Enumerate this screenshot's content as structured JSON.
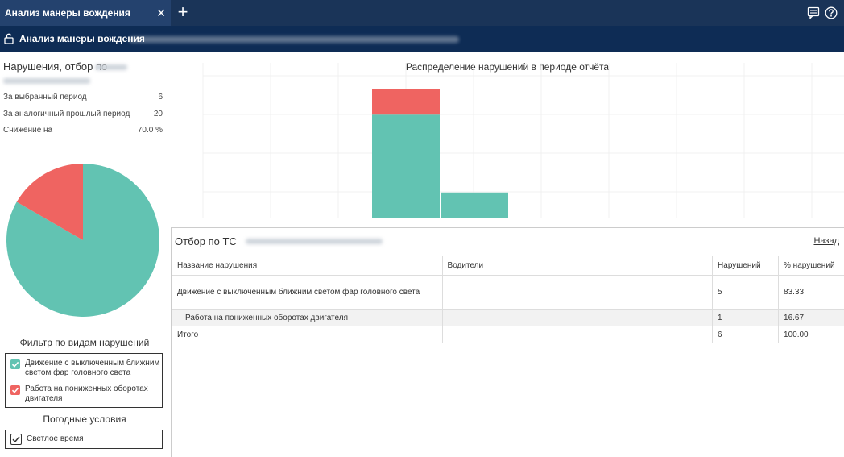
{
  "tab": {
    "title": "Анализ манеры вождения",
    "close": "✕",
    "add": "+"
  },
  "header": {
    "title": "Анализ манеры вождения"
  },
  "left": {
    "violations_title": "Нарушения, отбор по",
    "stats": [
      {
        "label": "За выбранный период",
        "value": "6"
      },
      {
        "label": "За аналогичный прошлый период",
        "value": "20"
      },
      {
        "label": "Снижение на",
        "value": "70.0 %"
      }
    ],
    "filter_title": "Фильтр по видам нарушений",
    "filters": [
      {
        "label": "Движение с выключенным ближним светом фар головного света",
        "color": "#62c3b2"
      },
      {
        "label": "Работа на пониженных оборотах двигателя",
        "color": "#ef6461"
      }
    ],
    "weather_title": "Погодные условия",
    "weather": [
      {
        "label": "Светлое время"
      }
    ]
  },
  "chart_data": [
    {
      "type": "pie",
      "categories": [
        "Движение с выключенным ближним светом фар головного света",
        "Работа на пониженных оборотах двигателя"
      ],
      "values": [
        5,
        1
      ],
      "colors": [
        "#62c3b2",
        "#ef6461"
      ]
    },
    {
      "type": "bar",
      "title": "Распределение нарушений в периоде отчёта",
      "categories": [
        "",
        ""
      ],
      "series": [
        {
          "values": [
            4,
            1
          ],
          "color": "#62c3b2"
        },
        {
          "values": [
            1,
            0
          ],
          "color": "#ef6461"
        }
      ],
      "ylim": [
        0,
        5
      ],
      "grid": true
    }
  ],
  "table": {
    "title": "Отбор по ТС",
    "back_label": "Назад",
    "headers": [
      "Название нарушения",
      "Водители",
      "Нарушений",
      "% нарушений"
    ],
    "rows": [
      {
        "name": "Движение с выключенным ближним светом фар головного света",
        "drivers": "",
        "count": "5",
        "percent": "83.33"
      },
      {
        "name": "Работа на пониженных оборотах двигателя",
        "drivers": "",
        "count": "1",
        "percent": "16.67"
      }
    ],
    "total": {
      "name": "Итого",
      "drivers": "",
      "count": "6",
      "percent": "100.00"
    }
  },
  "icons": {
    "chat": "chat-icon",
    "help": "help-icon",
    "lock": "unlock-icon"
  }
}
